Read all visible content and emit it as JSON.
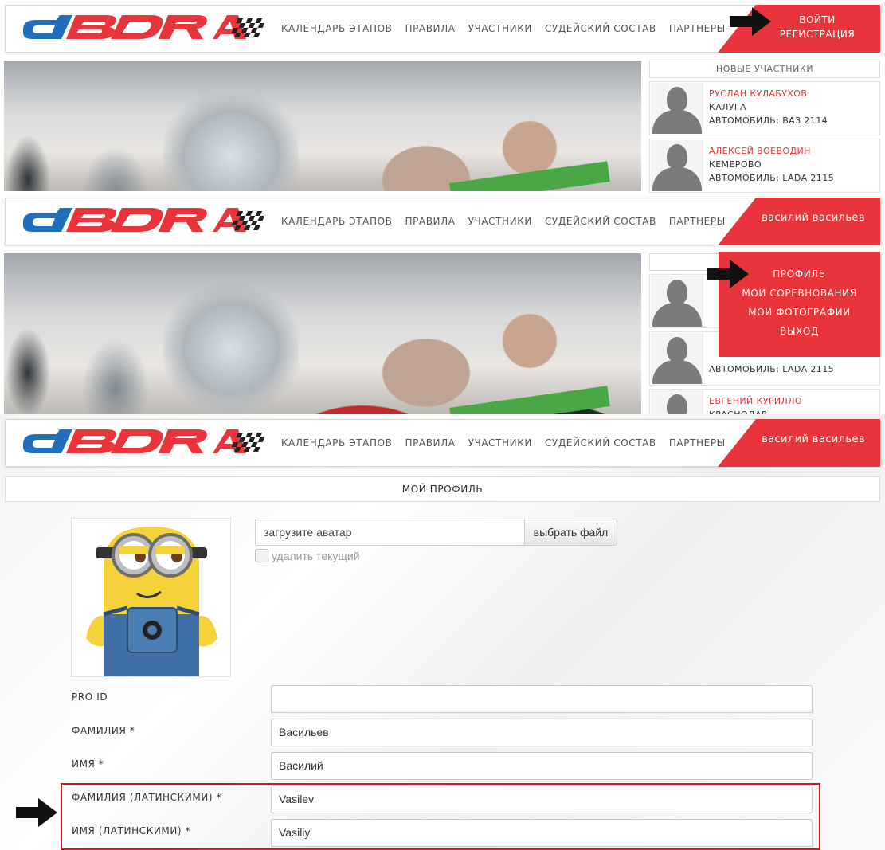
{
  "nav": [
    "Календарь этапов",
    "Правила",
    "Участники",
    "Судейский состав",
    "Партнеры"
  ],
  "auth": {
    "login": "Войти",
    "register": "Регистрация"
  },
  "user_name": "Василий Васильев",
  "sidebar": {
    "title": "Новые участники",
    "members": [
      {
        "name": "Руслан Кулабухов",
        "city": "Калуга",
        "car": "Автомобиль: ВАЗ 2114"
      },
      {
        "name": "Алексей Воеводин",
        "city": "Кемерово",
        "car": "Автомобиль: LADA 2115"
      },
      {
        "name": "Евгений Курилло",
        "city": "Краснодар",
        "car": ""
      }
    ],
    "panel2_car": "Автомобиль: LADA 2115"
  },
  "dropdown": [
    "Профиль",
    "Мои соревнования",
    "Мои фотографии",
    "Выход"
  ],
  "profile": {
    "title": "Мой профиль",
    "upload_placeholder": "загрузите аватар",
    "upload_button": "выбрать файл",
    "delete_label": "удалить текущий",
    "fields": [
      {
        "label": "PRO ID",
        "value": ""
      },
      {
        "label": "Фамилия *",
        "value": "Васильев"
      },
      {
        "label": "Имя *",
        "value": "Василий"
      },
      {
        "label": "Фамилия (латинскими) *",
        "value": "Vasilev"
      },
      {
        "label": "Имя (латинскими) *",
        "value": "Vasiliy"
      }
    ]
  },
  "colors": {
    "accent": "#e8343a",
    "logo_blue": "#1f6fbd",
    "highlight": "#d8181f"
  },
  "icons": [
    "pointer-arrow-icon",
    "avatar-placeholder-icon",
    "minion-avatar"
  ]
}
